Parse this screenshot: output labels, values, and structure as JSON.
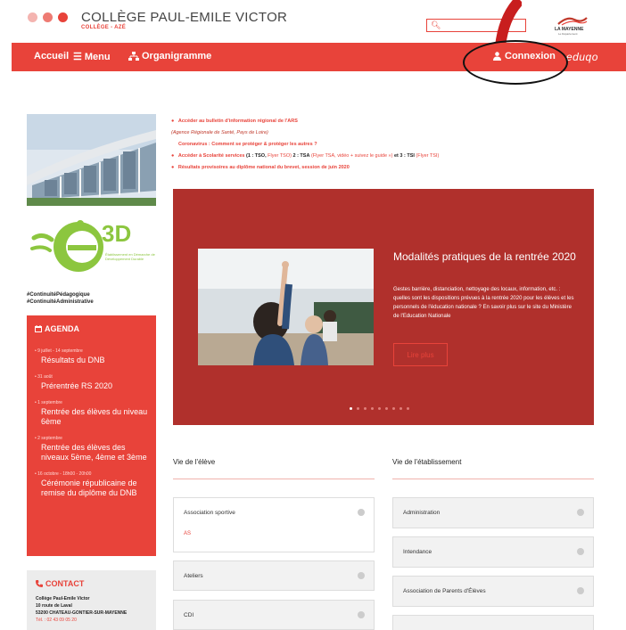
{
  "colors": {
    "accent": "#e8433a",
    "slider_bg": "#b0302c",
    "dot1": "#f4b4b0",
    "dot2": "#ee7b73",
    "dot3": "#e8433a"
  },
  "header": {
    "title": "COLLÈGE PAUL-EMILE VICTOR",
    "subtitle": "COLLÈGE - AZÉ",
    "search_icon": "search-icon",
    "partner_logo": "LA MAYENNE",
    "partner_logo_sub": "Le Département"
  },
  "nav": {
    "home": "Accueil",
    "menu": "Menu",
    "org": "Organigramme",
    "login": "Connexion",
    "eduqo": "eduqo"
  },
  "sidebar": {
    "e3d_label": "3D",
    "e3d_text": "Établissement en Démarche de Développement Durable",
    "hashtag1": "#ContinuitéPédagogique",
    "hashtag2": "#ContinuitéAdministrative",
    "agenda_title": "AGENDA",
    "agenda": [
      {
        "date": "9 juillet - 14 septembre",
        "text": "Résultats du DNB"
      },
      {
        "date": "31 août",
        "text": "Prérentrée RS 2020"
      },
      {
        "date": "1 septembre",
        "text": "Rentrée des élèves du niveau 6ème"
      },
      {
        "date": "2 septembre",
        "text": "Rentrée des élèves des niveaux 5ème, 4ème et 3ème"
      },
      {
        "date": "16 octobre - 18h00 - 20h00",
        "text": "Cérémonie républicaine de remise du diplôme du DNB"
      }
    ],
    "contact_title": "CONTACT",
    "contact_name": "Collège Paul-Emile Victor",
    "contact_street": "10 route de Laval",
    "contact_city": "53200 CHATEAU-GONTIER-SUR-MAYENNE",
    "contact_phone": "Tél. : 02 43 09 05 20"
  },
  "links": {
    "l1": "Accéder au bulletin d'information régional de l'ARS",
    "l1b": "(Agence Régionale de Santé, Pays de Loire)",
    "l2": "Coronavirus : Comment se protéger & protéger les autres ?",
    "l3a": "Accéder à Scolarité services",
    "l3b": "(1 : TSO,",
    "l3c": "Flyer TSO)",
    "l3d": "2 : TSA",
    "l3e": "(Flyer TSA, vidéo + suivez le guide »)",
    "l3f": "et 3 : TSI",
    "l3g": "(Flyer TSI)",
    "l4": "Résultats provisoires au diplôme national du brevet, session de juin 2020"
  },
  "slider": {
    "title": "Modalités pratiques de la rentrée 2020",
    "text": "Gestes barrière, distanciation, nettoyage des locaux, information, etc. : quelles sont les dispositions prévues à la rentrée 2020 pour les élèves et les personnels de l'éducation nationale ? En savoir plus sur le site du Ministère de l'Education Nationale",
    "button": "Lire plus",
    "page_count": 9,
    "active_page": 1
  },
  "sections": {
    "vie_eleve": "Vie de l'élève",
    "vie_etab": "Vie de l'établissement",
    "left_items": [
      {
        "label": "Association sportive",
        "sub": "AS"
      },
      {
        "label": "Ateliers"
      },
      {
        "label": "CDI"
      }
    ],
    "right_items": [
      {
        "label": "Administration"
      },
      {
        "label": "Intendance"
      },
      {
        "label": "Association de Parents d'Élèves"
      }
    ]
  }
}
